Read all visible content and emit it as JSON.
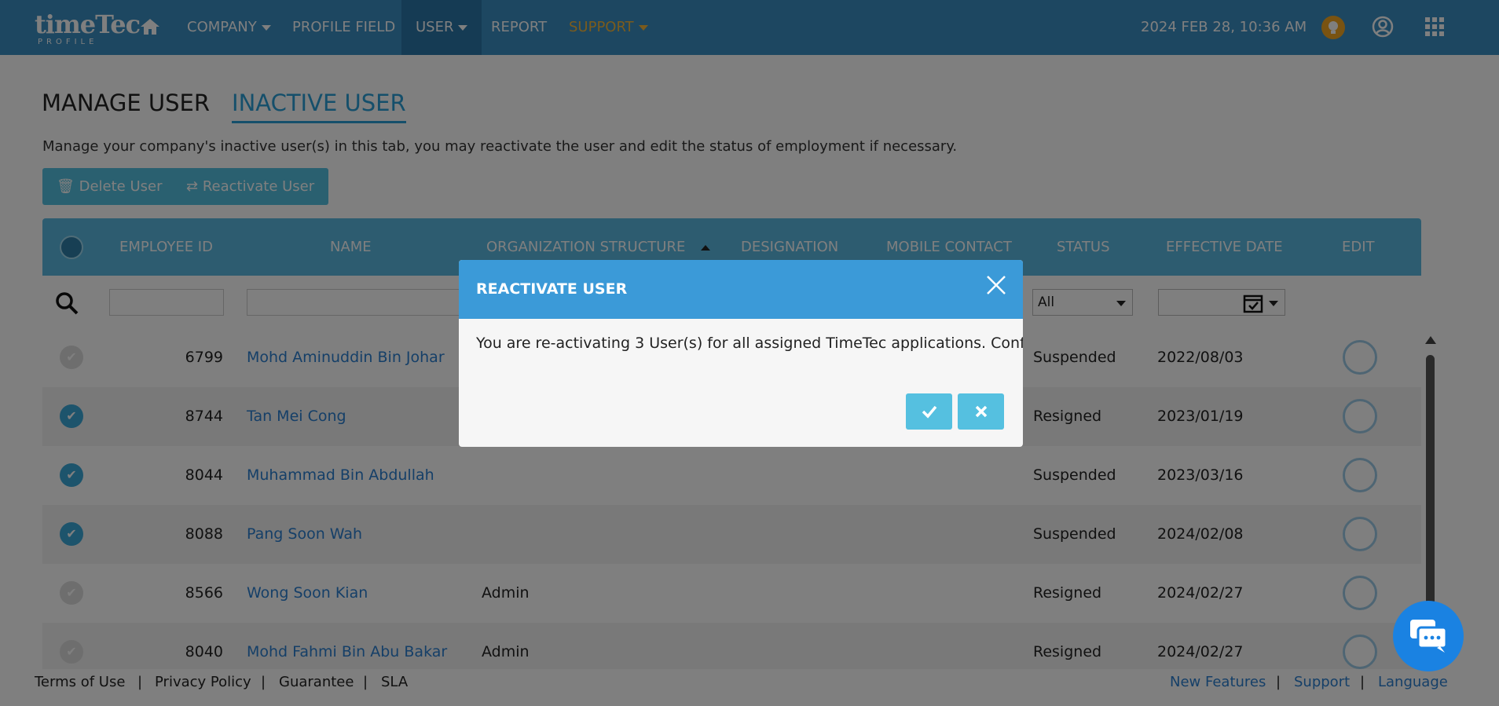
{
  "nav": {
    "logo_text": "timeTec",
    "logo_sub": "PROFILE",
    "items": [
      "COMPANY",
      "PROFILE FIELD",
      "USER",
      "REPORT",
      "SUPPORT"
    ],
    "datetime": "2024 FEB 28, 10:36 AM",
    "accent": "#3a8fc2",
    "support_color": "#f4b63a"
  },
  "page": {
    "tabs": [
      "MANAGE USER",
      "INACTIVE USER"
    ],
    "description": "Manage your company's inactive user(s) in this tab, you may reactivate the user and edit the status of employment if necessary.",
    "delete_label": "Delete User",
    "reactivate_label": "Reactivate User"
  },
  "table": {
    "headers": [
      "EMPLOYEE ID",
      "NAME",
      "ORGANIZATION STRUCTURE",
      "DESIGNATION",
      "MOBILE CONTACT",
      "STATUS",
      "EFFECTIVE DATE",
      "EDIT"
    ],
    "status_filter": "All",
    "rows": [
      {
        "id": "6799",
        "name": "Mohd Aminuddin Bin Johar",
        "org": "",
        "status": "Suspended",
        "date": "2022/08/03",
        "checked": false
      },
      {
        "id": "8744",
        "name": "Tan Mei Cong",
        "org": "",
        "status": "Resigned",
        "date": "2023/01/19",
        "checked": true
      },
      {
        "id": "8044",
        "name": "Muhammad Bin Abdullah",
        "org": "",
        "status": "Suspended",
        "date": "2023/03/16",
        "checked": true
      },
      {
        "id": "8088",
        "name": "Pang Soon Wah",
        "org": "",
        "status": "Suspended",
        "date": "2024/02/08",
        "checked": true
      },
      {
        "id": "8566",
        "name": "Wong Soon Kian",
        "org": "Admin",
        "status": "Resigned",
        "date": "2024/02/27",
        "checked": false
      },
      {
        "id": "8040",
        "name": "Mohd Fahmi Bin Abu Bakar",
        "org": "Admin",
        "status": "Resigned",
        "date": "2024/02/27",
        "checked": false
      }
    ]
  },
  "footer": {
    "left": [
      "Terms of Use",
      "Privacy Policy",
      "Guarantee",
      "SLA"
    ],
    "right": [
      "New Features",
      "Support",
      "Language"
    ]
  },
  "modal": {
    "title": "REACTIVATE USER",
    "message": "You are re-activating 3 User(s) for all assigned TimeTec applications. Confirm?"
  }
}
